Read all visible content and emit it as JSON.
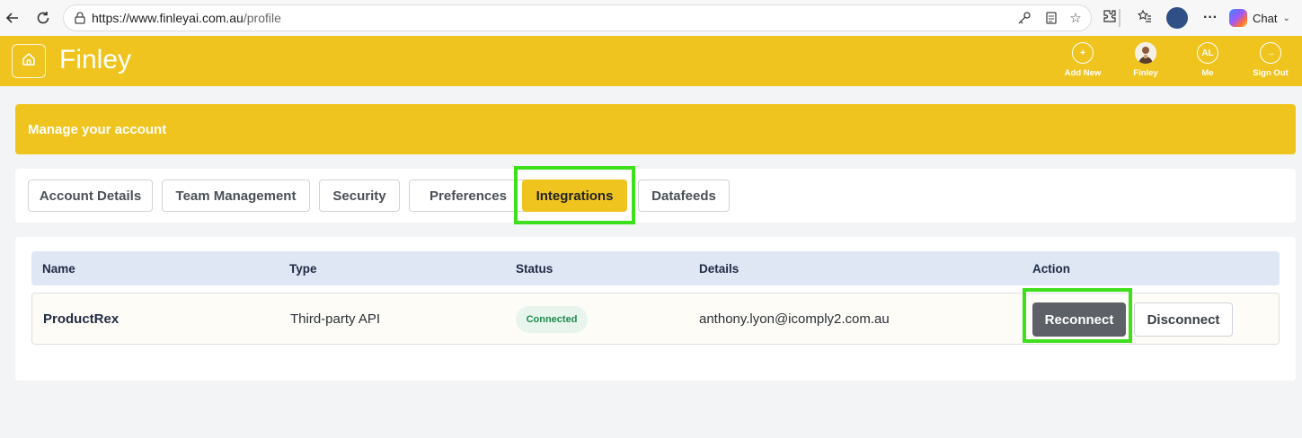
{
  "browser": {
    "url_host": "https://www.finleyai.com.au",
    "url_path": "/profile",
    "chat_label": "Chat"
  },
  "header": {
    "brand": "Finley",
    "actions": [
      {
        "label": "Add New",
        "glyph": "+"
      },
      {
        "label": "Finley",
        "glyph": ""
      },
      {
        "label": "Me",
        "glyph": "AL"
      },
      {
        "label": "Sign Out",
        "glyph": "→"
      }
    ]
  },
  "banner": {
    "title": "Manage your account"
  },
  "tabs": [
    {
      "label": "Account Details"
    },
    {
      "label": "Team Management"
    },
    {
      "label": "Security"
    },
    {
      "label": "Preferences"
    },
    {
      "label": "Integrations",
      "active": true
    },
    {
      "label": "Datafeeds"
    }
  ],
  "table": {
    "headers": [
      "Name",
      "Type",
      "Status",
      "Details",
      "Action"
    ],
    "rows": [
      {
        "name": "ProductRex",
        "type": "Third-party API",
        "status": "Connected",
        "details": "anthony.lyon@icomply2.com.au",
        "actions": [
          "Reconnect",
          "Disconnect"
        ]
      }
    ]
  },
  "colors": {
    "brand_yellow": "#f0c41e",
    "highlight_green": "#3ee01b",
    "status_green": "#1f8a4c"
  }
}
